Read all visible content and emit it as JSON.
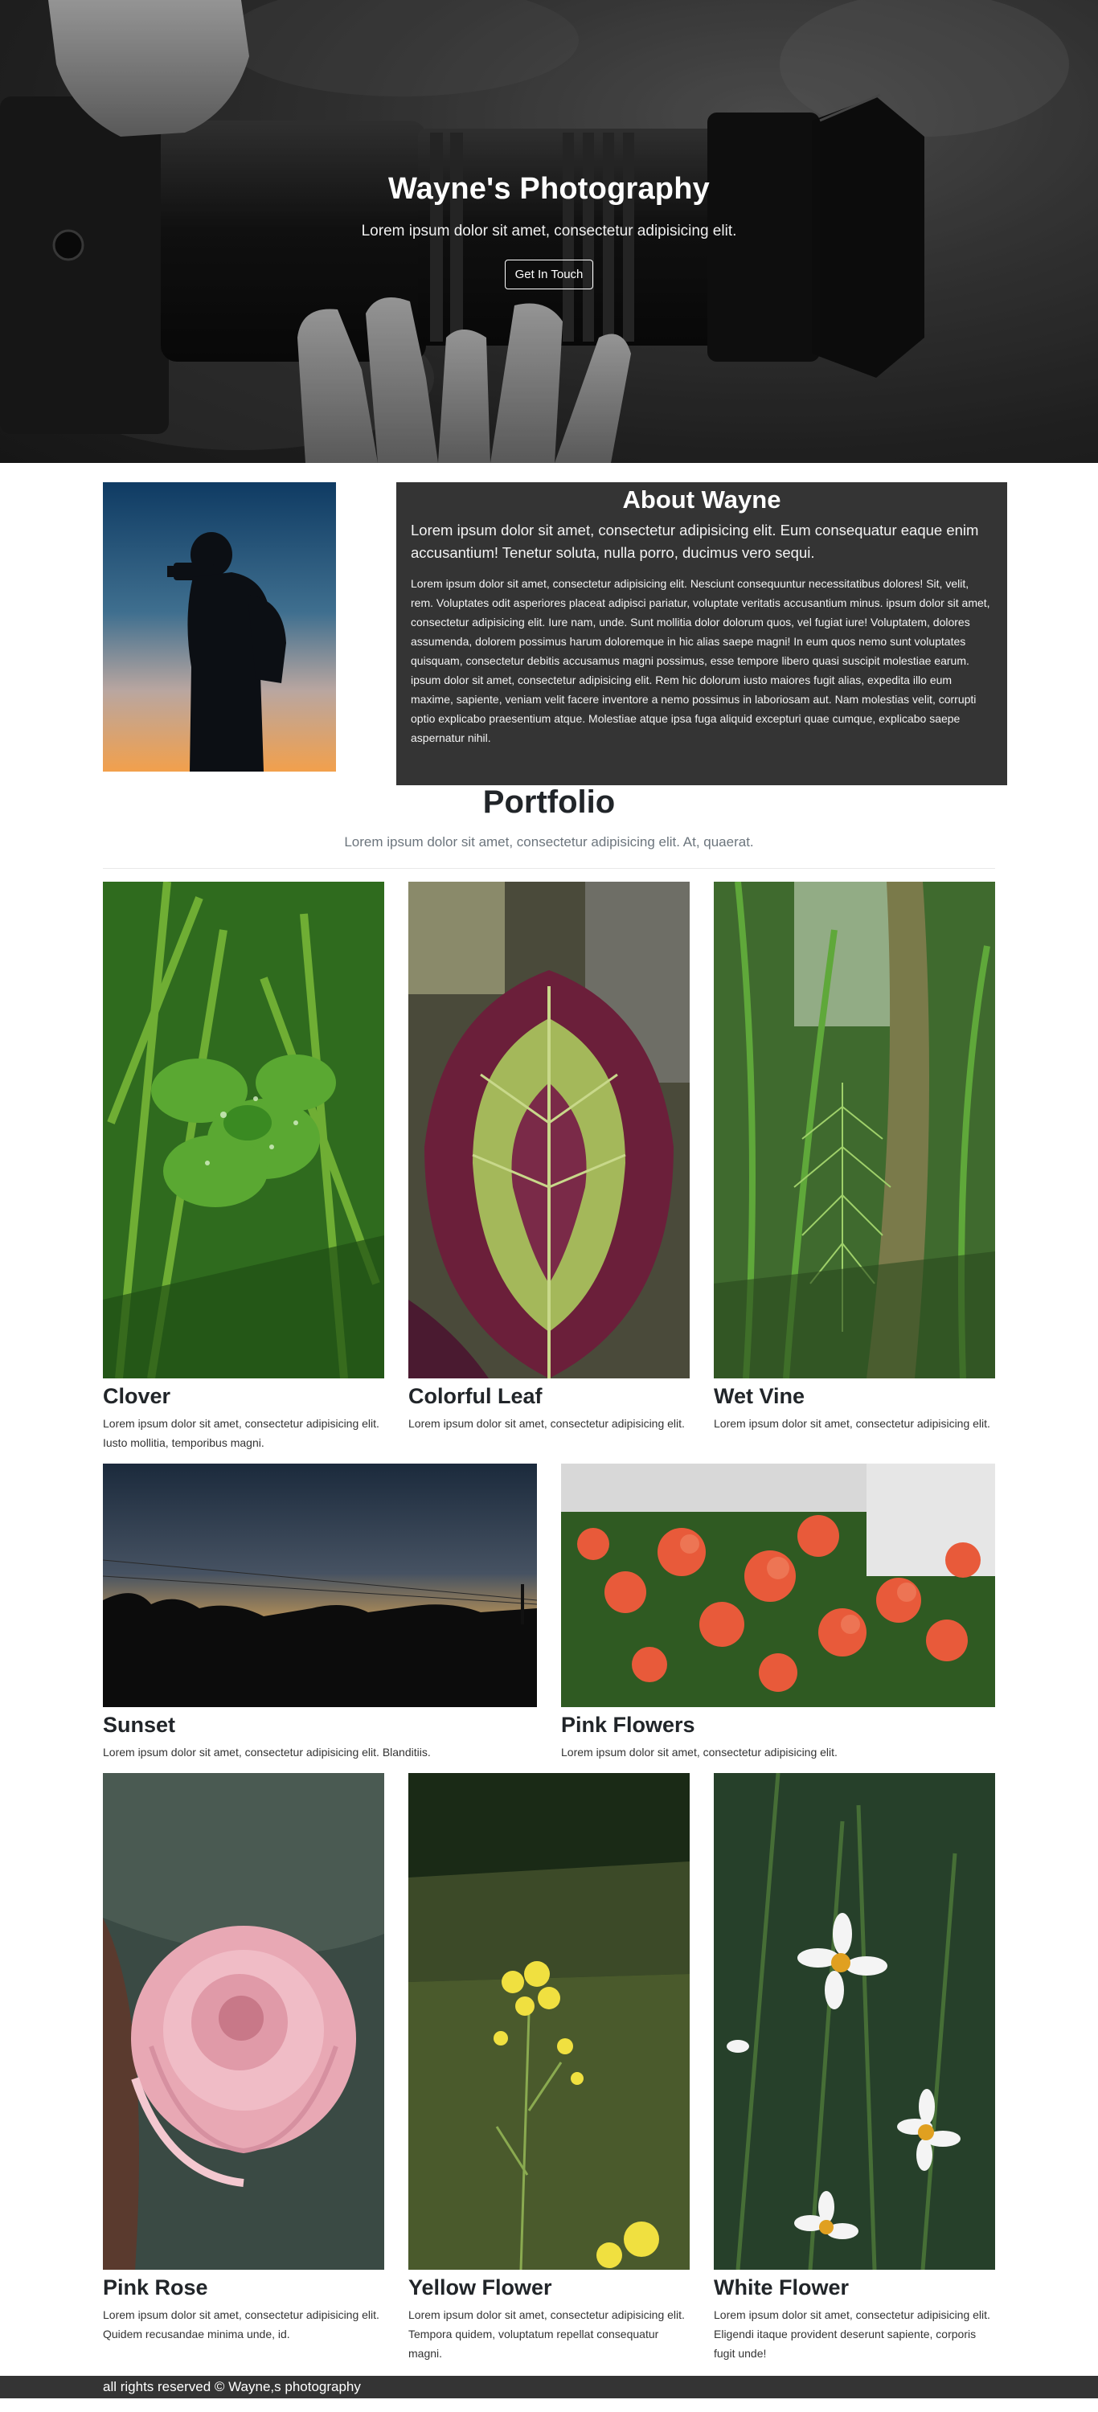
{
  "hero": {
    "title": "Wayne's Photography",
    "subtitle": "Lorem ipsum dolor sit amet, consectetur adipisicing elit.",
    "button_label": "Get In Touch"
  },
  "about": {
    "title": "About Wayne",
    "lead": "Lorem ipsum dolor sit amet, consectetur adipisicing elit. Eum consequatur eaque enim accusantium! Tenetur soluta, nulla porro, ducimus vero sequi.",
    "body": "Lorem ipsum dolor sit amet, consectetur adipisicing elit. Nesciunt consequuntur necessitatibus dolores! Sit, velit, rem. Voluptates odit asperiores placeat adipisci pariatur, voluptate veritatis accusantium minus. ipsum dolor sit amet, consectetur adipisicing elit. Iure nam, unde. Sunt mollitia dolor dolorum quos, vel fugiat iure! Voluptatem, dolores assumenda, dolorem possimus harum doloremque in hic alias saepe magni! In eum quos nemo sunt voluptates quisquam, consectetur debitis accusamus magni possimus, esse tempore libero quasi suscipit molestiae earum. ipsum dolor sit amet, consectetur adipisicing elit. Rem hic dolorum iusto maiores fugit alias, expedita illo eum maxime, sapiente, veniam velit facere inventore a nemo possimus in laboriosam aut. Nam molestias velit, corrupti optio explicabo praesentium atque. Molestiae atque ipsa fuga aliquid excepturi quae cumque, explicabo saepe aspernatur nihil."
  },
  "portfolio": {
    "title": "Portfolio",
    "subtitle": "Lorem ipsum dolor sit amet, consectetur adipisicing elit. At, quaerat.",
    "items": [
      {
        "title": "Clover",
        "text": "Lorem ipsum dolor sit amet, consectetur adipisicing elit. Iusto mollitia, temporibus magni."
      },
      {
        "title": "Colorful Leaf",
        "text": "Lorem ipsum dolor sit amet, consectetur adipisicing elit."
      },
      {
        "title": "Wet Vine",
        "text": "Lorem ipsum dolor sit amet, consectetur adipisicing elit."
      },
      {
        "title": "Sunset",
        "text": "Lorem ipsum dolor sit amet, consectetur adipisicing elit. Blanditiis."
      },
      {
        "title": "Pink Flowers",
        "text": "Lorem ipsum dolor sit amet, consectetur adipisicing elit."
      },
      {
        "title": "Pink Rose",
        "text": "Lorem ipsum dolor sit amet, consectetur adipisicing elit. Quidem recusandae minima unde, id."
      },
      {
        "title": "Yellow Flower",
        "text": "Lorem ipsum dolor sit amet, consectetur adipisicing elit. Tempora quidem, voluptatum repellat consequatur magni."
      },
      {
        "title": "White Flower",
        "text": "Lorem ipsum dolor sit amet, consectetur adipisicing elit. Eligendi itaque provident deserunt sapiente, corporis fugit unde!"
      }
    ]
  },
  "footer": {
    "text": "all rights reserved © Wayne,s photography"
  },
  "colors": {
    "dark_panel": "#343434",
    "hero_background": "#2b2b2b",
    "muted_text": "#6c757d"
  }
}
